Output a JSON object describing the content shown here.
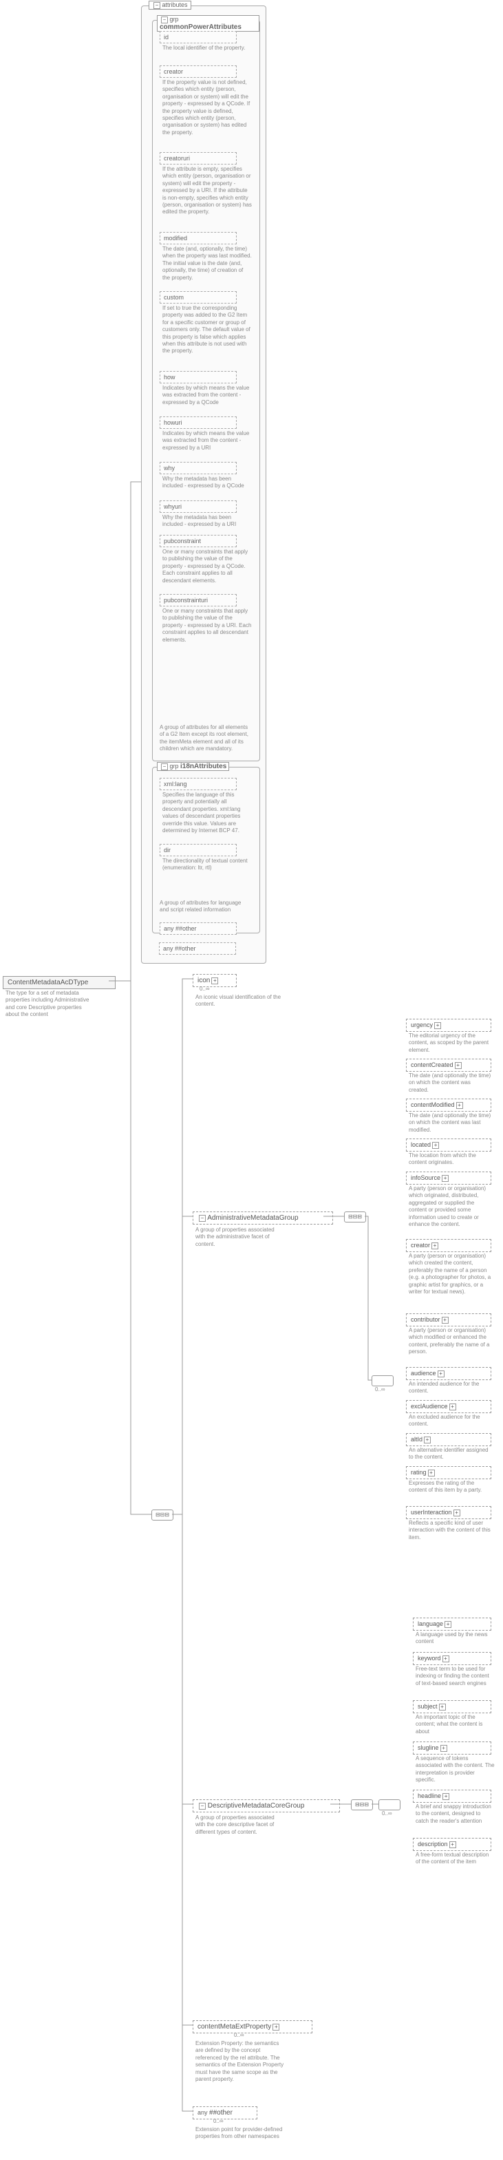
{
  "root": {
    "name": "ContentMetadataAcDType",
    "desc": "The type for a set of metadata properties including Administrative and core Descriptive properties about the content"
  },
  "attrGroups": {
    "main": "attributes",
    "power": {
      "name": "commonPowerAttributes",
      "items": [
        {
          "name": "id",
          "desc": "The local identifier of the property."
        },
        {
          "name": "creator",
          "desc": "If the property value is not defined, specifies which entity (person, organisation or system) will edit the property - expressed by a QCode. If the property value is defined, specifies which entity (person, organisation or system) has edited the property."
        },
        {
          "name": "creatoruri",
          "desc": "If the attribute is empty, specifies which entity (person, organisation or system) will edit the property - expressed by a URI. If the attribute is non-empty, specifies which entity (person, organisation or system) has edited the property."
        },
        {
          "name": "modified",
          "desc": "The date (and, optionally, the time) when the property was last modified. The initial value is the date (and, optionally, the time) of creation of the property."
        },
        {
          "name": "custom",
          "desc": "If set to true the corresponding property was added to the G2 Item for a specific customer or group of customers only. The default value of this property is false which applies when this attribute is not used with the property."
        },
        {
          "name": "how",
          "desc": "Indicates by which means the value was extracted from the content - expressed by a QCode"
        },
        {
          "name": "howuri",
          "desc": "Indicates by which means the value was extracted from the content - expressed by a URI"
        },
        {
          "name": "why",
          "desc": "Why the metadata has been included - expressed by a QCode"
        },
        {
          "name": "whyuri",
          "desc": "Why the metadata has been included - expressed by a URI"
        },
        {
          "name": "pubconstraint",
          "desc": "One or many constraints that apply to publishing the value of the property - expressed by a QCode. Each constraint applies to all descendant elements."
        },
        {
          "name": "pubconstrainturi",
          "desc": "One or many constraints that apply to publishing the value of the property - expressed by a URI. Each constraint applies to all descendant elements."
        }
      ],
      "groupDesc": "A group of attributes for all elements of a G2 Item except its root element, the itemMeta element and all of its children which are mandatory."
    },
    "i18n": {
      "name": "i18nAttributes",
      "items": [
        {
          "name": "xml:lang",
          "desc": "Specifies the language of this property and potentially all descendant properties. xml:lang values of descendant properties override this value. Values are determined by Internet BCP 47."
        },
        {
          "name": "dir",
          "desc": "The directionality of textual content (enumeration: ltr, rtl)"
        }
      ],
      "groupDesc": "A group of attributes for language and script related information"
    },
    "any1": "##other",
    "any2": "##other"
  },
  "icon": {
    "name": "icon",
    "desc": "An iconic visual identification of the content.",
    "range": "0..∞"
  },
  "admin": {
    "name": "AdministrativeMetadataGroup",
    "desc": "A group of properties associated with the administrative facet of content.",
    "items": [
      {
        "name": "urgency",
        "desc": "The editorial urgency of the content, as scoped by the parent element."
      },
      {
        "name": "contentCreated",
        "desc": "The date (and optionally the time) on which the content was created."
      },
      {
        "name": "contentModified",
        "desc": "The date (and optionally the time) on which the content was last modified."
      },
      {
        "name": "located",
        "desc": "The location from which the content originates."
      },
      {
        "name": "infoSource",
        "desc": "A party (person or organisation) which originated, distributed, aggregated or supplied the content or provided some information used to create or enhance the content."
      },
      {
        "name": "creator",
        "desc": "A party (person or organisation) which created the content, preferably the name of a person (e.g. a photographer for photos, a graphic artist for graphics, or a writer for textual news)."
      },
      {
        "name": "contributor",
        "desc": "A party (person or organisation) which modified or enhanced the content, preferably the name of a person."
      },
      {
        "name": "audience",
        "desc": "An intended audience for the content."
      },
      {
        "name": "exclAudience",
        "desc": "An excluded audience for the content."
      },
      {
        "name": "altId",
        "desc": "An alternative identifier assigned to the content."
      },
      {
        "name": "rating",
        "desc": "Expresses the rating of the content of this item by a party."
      },
      {
        "name": "userInteraction",
        "desc": "Reflects a specific kind of user interaction with the content of this item."
      }
    ],
    "innerRange": "0..∞"
  },
  "descr": {
    "name": "DescriptiveMetadataCoreGroup",
    "desc": "A group of properties associated with the core descriptive facet of different types of content.",
    "items": [
      {
        "name": "language",
        "desc": "A language used by the news content"
      },
      {
        "name": "keyword",
        "desc": "Free-text term to be used for indexing or finding the content of text-based search engines"
      },
      {
        "name": "subject",
        "desc": "An important topic of the content; what the content is about"
      },
      {
        "name": "slugline",
        "desc": "A sequence of tokens associated with the content. The interpretation is provider specific."
      },
      {
        "name": "headline",
        "desc": "A brief and snappy introduction to the content, designed to catch the reader's attention"
      },
      {
        "name": "description",
        "desc": "A free-form textual description of the content of the item"
      }
    ],
    "innerRange": "0..∞"
  },
  "ext": {
    "name": "contentMetaExtProperty",
    "desc": "Extension Property: the semantics are defined by the concept referenced by the rel attribute. The semantics of the Extension Property must have the same scope as the parent property.",
    "range": "0..∞"
  },
  "anyEl": {
    "name": "##other",
    "desc": "Extension point for provider-defined properties from other namespaces",
    "range": "0..∞"
  }
}
